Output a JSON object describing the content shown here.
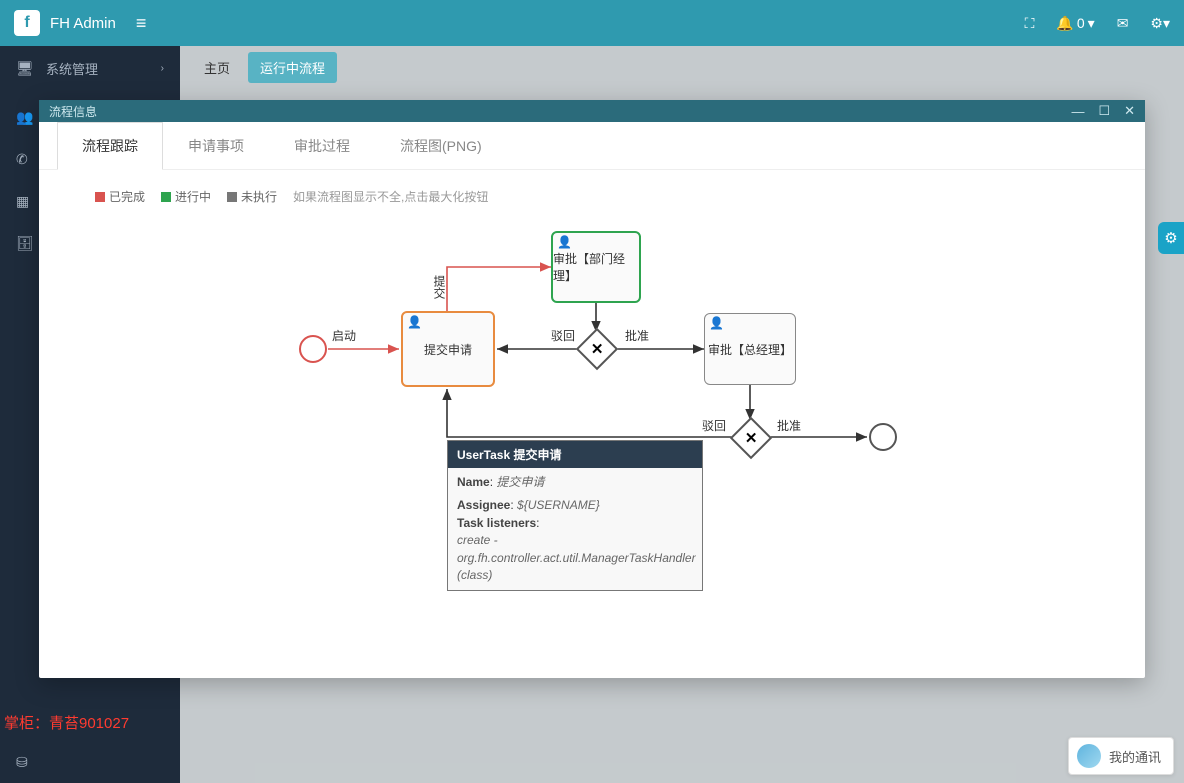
{
  "header": {
    "app_title": "FH Admin",
    "notify_label": "0"
  },
  "sidebar": {
    "items": [
      {
        "label": "系统管理",
        "icon": "🖥",
        "chev": true
      },
      {
        "label": "",
        "icon": "👥",
        "chev": true
      },
      {
        "label": "",
        "icon": "📞",
        "chev": false
      },
      {
        "label": "",
        "icon": "▦",
        "chev": false
      },
      {
        "label": "",
        "icon": "🗄",
        "chev": false
      }
    ]
  },
  "tabs": {
    "main": "主页",
    "active": "运行中流程"
  },
  "modal": {
    "title": "流程信息",
    "tabs": [
      "流程跟踪",
      "申请事项",
      "审批过程",
      "流程图(PNG)"
    ],
    "legend": {
      "done": "已完成",
      "running": "进行中",
      "pending": "未执行",
      "hint": "如果流程图显示不全,点击最大化按钮"
    }
  },
  "diagram": {
    "start_label": "启动",
    "submit_label": "提交申请",
    "submit_edge": "提交",
    "audit1_label": "审批【部门经理】",
    "audit2_label": "审批【总经理】",
    "reject1": "驳回",
    "approve1": "批准",
    "reject2": "驳回",
    "approve2": "批准"
  },
  "tooltip": {
    "header": "UserTask 提交申请",
    "name_k": "Name",
    "name_v": "提交申请",
    "assignee_k": "Assignee",
    "assignee_v": "${USERNAME}",
    "listeners_k": "Task listeners",
    "listeners_v": "create - org.fh.controller.act.util.ManagerTaskHandler (class)"
  },
  "watermark": "掌柜：青苔901027",
  "chat": {
    "label": "我的通讯"
  }
}
